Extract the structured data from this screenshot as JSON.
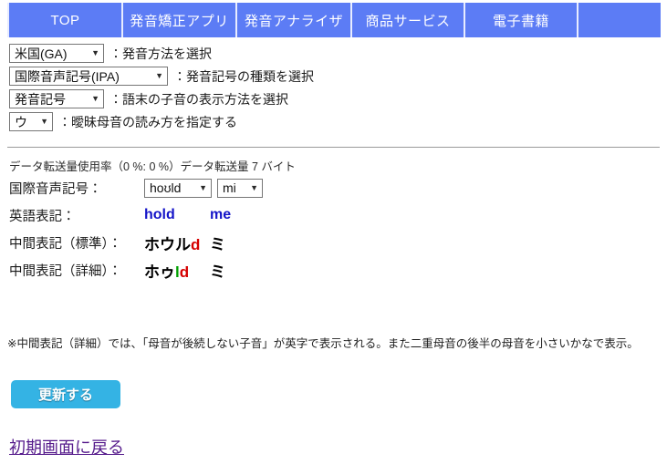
{
  "nav": {
    "items": [
      {
        "label": "TOP"
      },
      {
        "label": "発音矯正アプリ"
      },
      {
        "label": "発音アナライザ"
      },
      {
        "label": "商品サービス"
      },
      {
        "label": "電子書籍"
      }
    ]
  },
  "options": [
    {
      "value": "米国(GA)",
      "caret": "▼",
      "description": "：発音方法を選択"
    },
    {
      "value": "国際音声記号(IPA)",
      "caret": "▼",
      "description": "：発音記号の種類を選択"
    },
    {
      "value": "発音記号",
      "caret": "▼",
      "description": "：語末の子音の表示方法を選択"
    },
    {
      "value": "ウ",
      "caret": "▼",
      "description": "：曖昧母音の読み方を指定する"
    }
  ],
  "transfer": {
    "text": "データ転送量使用率（0 %: 0 %）データ転送量 7 バイト"
  },
  "results": {
    "ipa": {
      "label": "国際音声記号：",
      "tokens": [
        {
          "value": "hoʊld",
          "caret": "▼"
        },
        {
          "value": "mi",
          "caret": "▼"
        }
      ]
    },
    "english": {
      "label": "英語表記：",
      "tokens": [
        "hold",
        "me"
      ]
    },
    "kana_standard": {
      "label": "中間表記（標準）：",
      "tokens": [
        {
          "black": "ホウル",
          "green": "",
          "red": "d"
        },
        {
          "black": "ミ",
          "green": "",
          "red": ""
        }
      ]
    },
    "kana_detail": {
      "label": "中間表記（詳細）：",
      "tokens": [
        {
          "black": "ホゥ",
          "green": "l",
          "red": "d"
        },
        {
          "black": "ミ",
          "green": "",
          "red": ""
        }
      ]
    }
  },
  "note": {
    "text": "※中間表記（詳細）では、「母音が後続しない子音」が英字で表示される。また二重母音の後半の母音を小さいかなで表示。"
  },
  "update_button": {
    "label": "更新する"
  },
  "back_link": {
    "label": "初期画面に戻る"
  },
  "colors": {
    "nav_background": "#5c7cf5",
    "nav_text": "#ffffff",
    "english_text": "#1414c8",
    "consonant_red": "#d60000",
    "consonant_green": "#00a000",
    "update_button": "#34b3e4",
    "back_link": "#551a8b"
  }
}
